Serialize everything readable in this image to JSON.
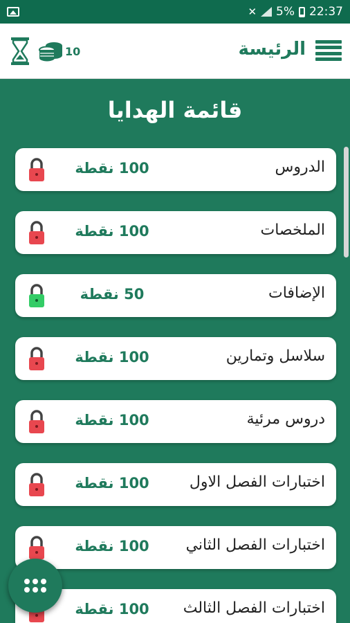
{
  "status_bar": {
    "battery": "5%",
    "time": "22:37",
    "icons": [
      "gallery-icon",
      "mute-icon",
      "signal-icon",
      "battery-icon"
    ]
  },
  "app_bar": {
    "title": "الرئيسة",
    "coins": "10",
    "icons": [
      "menu-icon",
      "hourglass-icon",
      "coins-icon"
    ]
  },
  "heading": "قائمة الهدايا",
  "colors": {
    "primary": "#1f7a5c",
    "lock_locked": "#e8474f",
    "lock_unlocked": "#33cc66"
  },
  "gifts": [
    {
      "label": "الدروس",
      "points": "100 نقطة",
      "locked": true
    },
    {
      "label": "الملخصات",
      "points": "100 نقطة",
      "locked": true
    },
    {
      "label": "الإضافات",
      "points": "50 نقطة",
      "locked": false
    },
    {
      "label": "سلاسل وتمارين",
      "points": "100 نقطة",
      "locked": true
    },
    {
      "label": "دروس مرئية",
      "points": "100 نقطة",
      "locked": true
    },
    {
      "label": "اختبارات الفصل الاول",
      "points": "100 نقطة",
      "locked": true
    },
    {
      "label": "اختبارات الفصل الثاني",
      "points": "100 نقطة",
      "locked": true
    },
    {
      "label": "اختبارات الفصل الثالث",
      "points": "100 نقطة",
      "locked": true
    }
  ]
}
